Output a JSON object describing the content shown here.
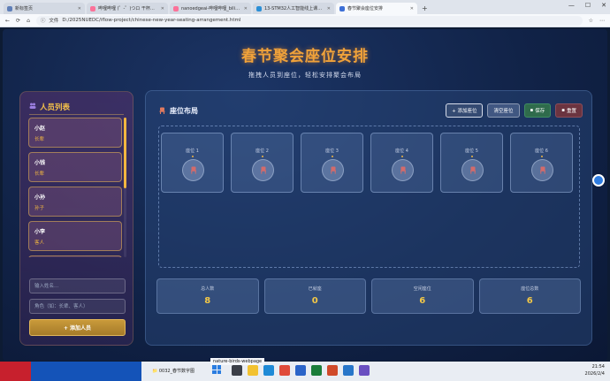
{
  "browser": {
    "tabs": [
      {
        "label": "新标签页",
        "color": "#5f7fb8"
      },
      {
        "label": "哔哩哔哩 (゜-゜)つロ 干杯~-bilibili",
        "color": "#fb7299"
      },
      {
        "label": "nanoedgeai-哔哩哔哩_bilibili",
        "color": "#fb7299"
      },
      {
        "label": "13-STM32人工智能线上课程：STM",
        "color": "#2b8fd6"
      },
      {
        "label": "春节聚会座位安排",
        "color": "#3d6fd6"
      }
    ],
    "new_tab": "+",
    "file_label": "文件",
    "url": "D:/2025NUEDC/iflow-project/chinese-new-year-seating-arrangement.html"
  },
  "page": {
    "title": "春节聚会座位安排",
    "subtitle": "拖拽人员到座位，轻松安排聚会布局"
  },
  "sidebar": {
    "title": "人员列表",
    "people": [
      {
        "name": "小赵",
        "role": "长辈"
      },
      {
        "name": "小钱",
        "role": "长辈"
      },
      {
        "name": "小孙",
        "role": "孙子"
      },
      {
        "name": "小李",
        "role": "客人"
      }
    ],
    "name_placeholder": "输入姓名...",
    "role_placeholder": "角色（如：长辈、客人）",
    "add_button": "+ 添加人员"
  },
  "seating": {
    "title": "座位布局",
    "buttons": {
      "add_seat": "+ 添加座位",
      "clear_seats": "清空座位",
      "save": "保存",
      "reset": "重置"
    },
    "seats": [
      "座位 1",
      "座位 2",
      "座位 3",
      "座位 4",
      "座位 5",
      "座位 6"
    ]
  },
  "stats": [
    {
      "label": "总人数",
      "value": "8"
    },
    {
      "label": "已就座",
      "value": "0"
    },
    {
      "label": "空闲座位",
      "value": "6"
    },
    {
      "label": "座位总数",
      "value": "6"
    }
  ],
  "taskbar": {
    "folder": "0032_春节数字图",
    "popup": "nature-birds-webpage",
    "time": "21:54",
    "date": "2026/2/4"
  },
  "colors": {
    "accent": "#f2b640",
    "title": "#f0a23a",
    "background": "#112348"
  }
}
